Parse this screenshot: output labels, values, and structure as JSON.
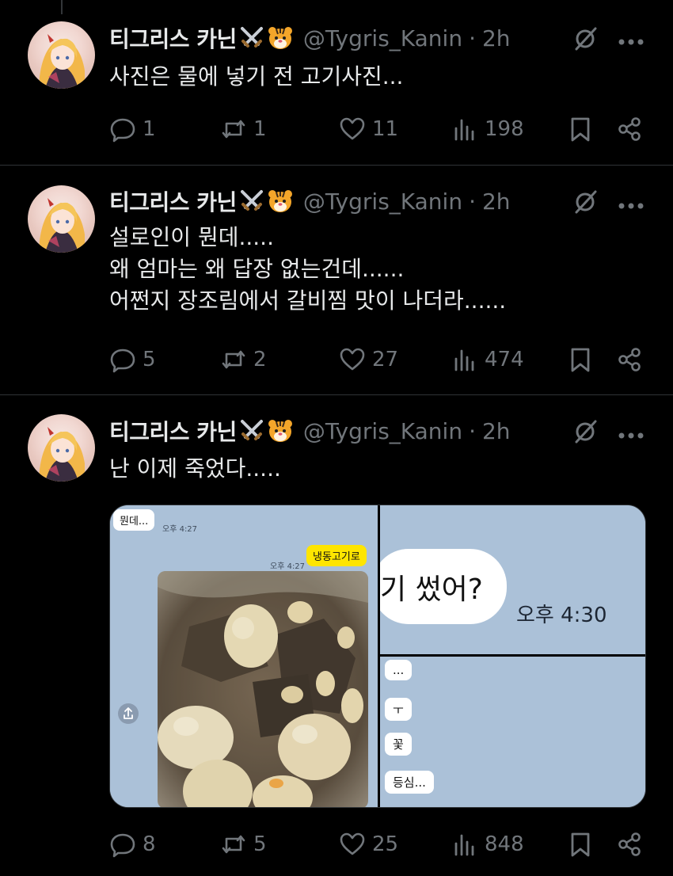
{
  "author": {
    "name": "티그리스 카닌",
    "handle": "@Tygris_Kanin",
    "separator": "·",
    "time": "2h",
    "name_emojis": [
      "crossed-swords-icon",
      "tiger-face-icon"
    ]
  },
  "tweets": [
    {
      "text": "사진은 물에 넣기 전 고기사진...",
      "replies": "1",
      "reposts": "1",
      "likes": "11",
      "views": "198"
    },
    {
      "text": "설로인이 뭔데.....\n왜 엄마는 왜 답장 없는건데......\n어쩐지 장조림에서 갈비찜 맛이 나더라......",
      "replies": "5",
      "reposts": "2",
      "likes": "27",
      "views": "474"
    },
    {
      "text": "난 이제 죽었다.....",
      "replies": "8",
      "reposts": "5",
      "likes": "25",
      "views": "848",
      "media": {
        "left_panel": {
          "bubble_top": "뭔데...",
          "bubble_top_time": "오후 4:27",
          "bubble_yellow": "냉동고기로",
          "bubble_yellow_time": "오후 4:27"
        },
        "top_right_panel": {
          "bubble_text": "기 썼어?",
          "time": "오후 4:30"
        },
        "bottom_right_panel": {
          "bubbles": [
            "...",
            "ㅜ",
            "꽃",
            "등심..."
          ]
        }
      }
    }
  ],
  "colors": {
    "background": "#000000",
    "text": "#e7e9ea",
    "muted": "#71767b",
    "divider": "#2f3336",
    "chat_bg": "#abc1d8",
    "kakao_yellow": "#fee500"
  }
}
